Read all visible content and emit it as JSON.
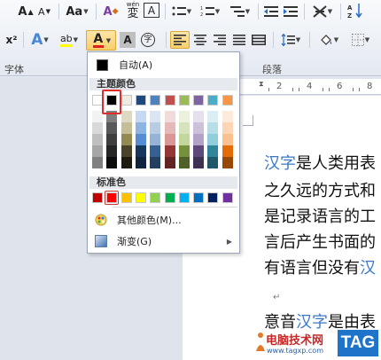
{
  "ribbon": {
    "groups": {
      "font": "字体",
      "paragraph": "段落"
    },
    "row1": {
      "grow_font": "A",
      "shrink_font": "A",
      "change_case": "Aa",
      "clear_format": "A",
      "phonetic_guide": "wén",
      "phonetic_char": "変",
      "char_border": "A"
    },
    "row2": {
      "subscript_tail": "x²",
      "text_effect": "A",
      "highlight": "ab",
      "font_color": "A",
      "char_shading": "A",
      "enclosed_char": "字"
    }
  },
  "font_color_menu": {
    "auto_label": "自动(A)",
    "theme_colors_label": "主题颜色",
    "theme_colors": [
      "#ffffff",
      "#000000",
      "#eeece1",
      "#1f497d",
      "#4f81bd",
      "#c0504d",
      "#9bbb59",
      "#8064a2",
      "#4bacc6",
      "#f79646"
    ],
    "theme_tints": [
      [
        "#f2f2f2",
        "#d9d9d9",
        "#bfbfbf",
        "#a6a6a6",
        "#808080"
      ],
      [
        "#7f7f7f",
        "#595959",
        "#3f3f3f",
        "#262626",
        "#0c0c0c"
      ],
      [
        "#ddd9c3",
        "#c4bd97",
        "#938953",
        "#494429",
        "#1d1b10"
      ],
      [
        "#c6d9f0",
        "#8db3e2",
        "#548dd4",
        "#17365d",
        "#0f243e"
      ],
      [
        "#dbe5f1",
        "#b8cce4",
        "#95b3d7",
        "#366092",
        "#244061"
      ],
      [
        "#f2dcdb",
        "#e5b9b7",
        "#d99694",
        "#953734",
        "#632423"
      ],
      [
        "#ebf1dd",
        "#d7e3bc",
        "#c3d69b",
        "#76923c",
        "#4f6128"
      ],
      [
        "#e5e0ec",
        "#ccc1d9",
        "#b2a2c7",
        "#5f497a",
        "#3f3151"
      ],
      [
        "#dbeef3",
        "#b7dde8",
        "#92cddc",
        "#31859b",
        "#205867"
      ],
      [
        "#fdeada",
        "#fbd5b5",
        "#fac08f",
        "#e36c09",
        "#974806"
      ]
    ],
    "standard_colors_label": "标准色",
    "standard_colors": [
      "#c00000",
      "#ff0000",
      "#ffc000",
      "#ffff00",
      "#92d050",
      "#00b050",
      "#00b0f0",
      "#0070c0",
      "#002060",
      "#7030a0"
    ],
    "more_colors_label": "其他颜色(M)...",
    "gradient_label": "渐变(G)",
    "selected_theme_color_index": 1,
    "selected_standard_color_index": 1
  },
  "document": {
    "ruler_numbers": [
      "2",
      "4",
      "6",
      "8"
    ],
    "line1_link": "汉字",
    "line1_rest": "是人类用表",
    "line2": "之久远的方式和",
    "line3": "是记录语言的工",
    "line4": "言后产生书面的",
    "line5_start": "有语言但没有",
    "line5_end": "汉",
    "line6_start": "意音",
    "line6_link": "汉字",
    "line6_end": "是由表"
  },
  "watermark": {
    "site_name": "电脑技术网",
    "tag": "TAG",
    "url": "www.tagxp.com"
  },
  "colors": {
    "font_color_red": "#e02020",
    "selection_red": "#e12c2c",
    "link_blue": "#3b78c4"
  }
}
